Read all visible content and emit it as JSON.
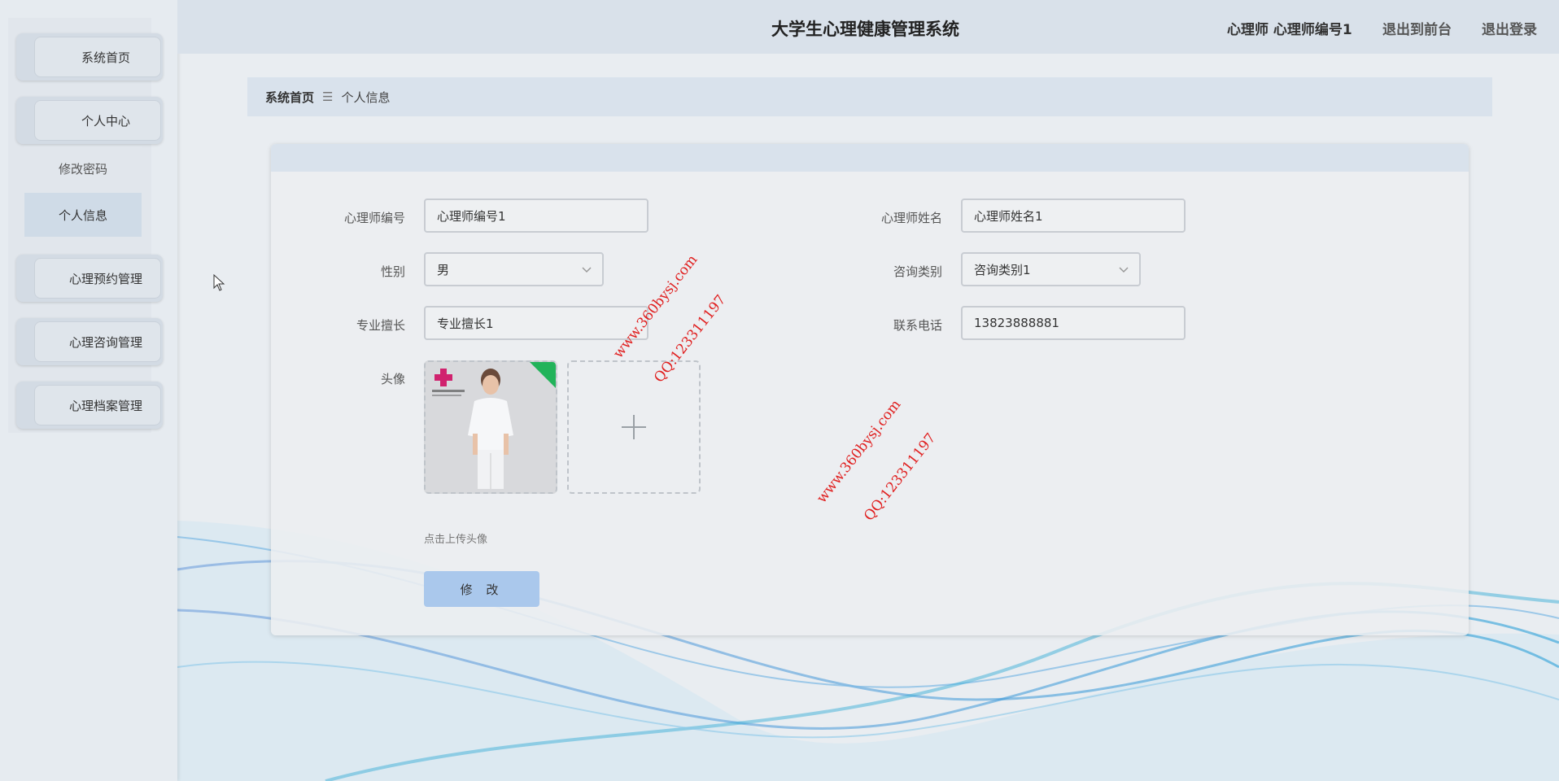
{
  "header": {
    "title": "大学生心理健康管理系统",
    "user_label": "心理师 心理师编号1",
    "front_link": "退出到前台",
    "logout_link": "退出登录"
  },
  "sidebar": {
    "items": [
      {
        "label": "系统首页"
      },
      {
        "label": "个人中心"
      },
      {
        "label": "心理预约管理"
      },
      {
        "label": "心理咨询管理"
      },
      {
        "label": "心理档案管理"
      }
    ],
    "submenu": [
      {
        "label": "修改密码"
      },
      {
        "label": "个人信息"
      }
    ]
  },
  "breadcrumb": {
    "home": "系统首页",
    "separator": "☰",
    "current": "个人信息"
  },
  "form": {
    "fields": [
      {
        "label": "心理师编号",
        "value": "心理师编号1"
      },
      {
        "label": "心理师姓名",
        "value": "心理师姓名1"
      },
      {
        "label": "性别",
        "value": "男"
      },
      {
        "label": "咨询类别",
        "value": "咨询类别1"
      },
      {
        "label": "专业擅长",
        "value": "专业擅长1"
      },
      {
        "label": "联系电话",
        "value": "13823888881"
      }
    ],
    "avatar_label": "头像",
    "upload_hint": "点击上传头像",
    "submit_label": "修 改"
  },
  "watermarks": [
    {
      "site": "www.360bysj.com",
      "qq": "QQ:123311197"
    },
    {
      "site": "www.360bysj.com",
      "qq": "QQ:123311197"
    }
  ],
  "colors": {
    "header_bg": "#d9e1ea",
    "submit_bg": "#aac8ec",
    "watermark": "#e02020"
  }
}
